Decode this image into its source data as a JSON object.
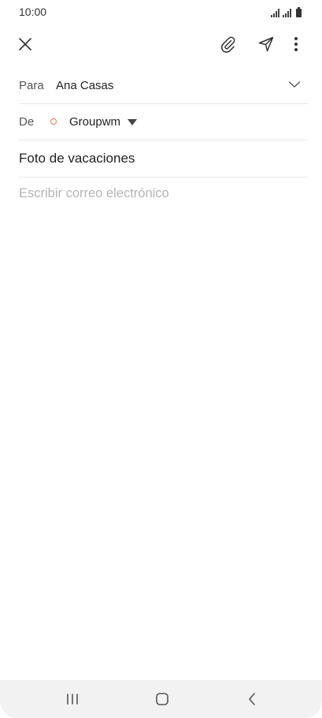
{
  "status_bar": {
    "time": "10:00"
  },
  "toolbar": {
    "close_icon": "close-icon",
    "attach_icon": "paperclip-icon",
    "send_icon": "send-icon",
    "more_icon": "more-vertical-icon"
  },
  "compose": {
    "to_label": "Para",
    "to_value": "Ana Casas",
    "from_label": "De",
    "from_value": "Groupwm",
    "subject": "Foto de vacaciones",
    "body_placeholder": "Escribir correo electrónico"
  },
  "colors": {
    "account_dot": "#e8735a",
    "divider": "#e8e8e8",
    "placeholder": "#b5b5b5",
    "nav_bar": "#f2f2f2"
  },
  "nav_bar": {
    "recents_icon": "recents-icon",
    "home_icon": "home-icon",
    "back_icon": "back-icon"
  }
}
